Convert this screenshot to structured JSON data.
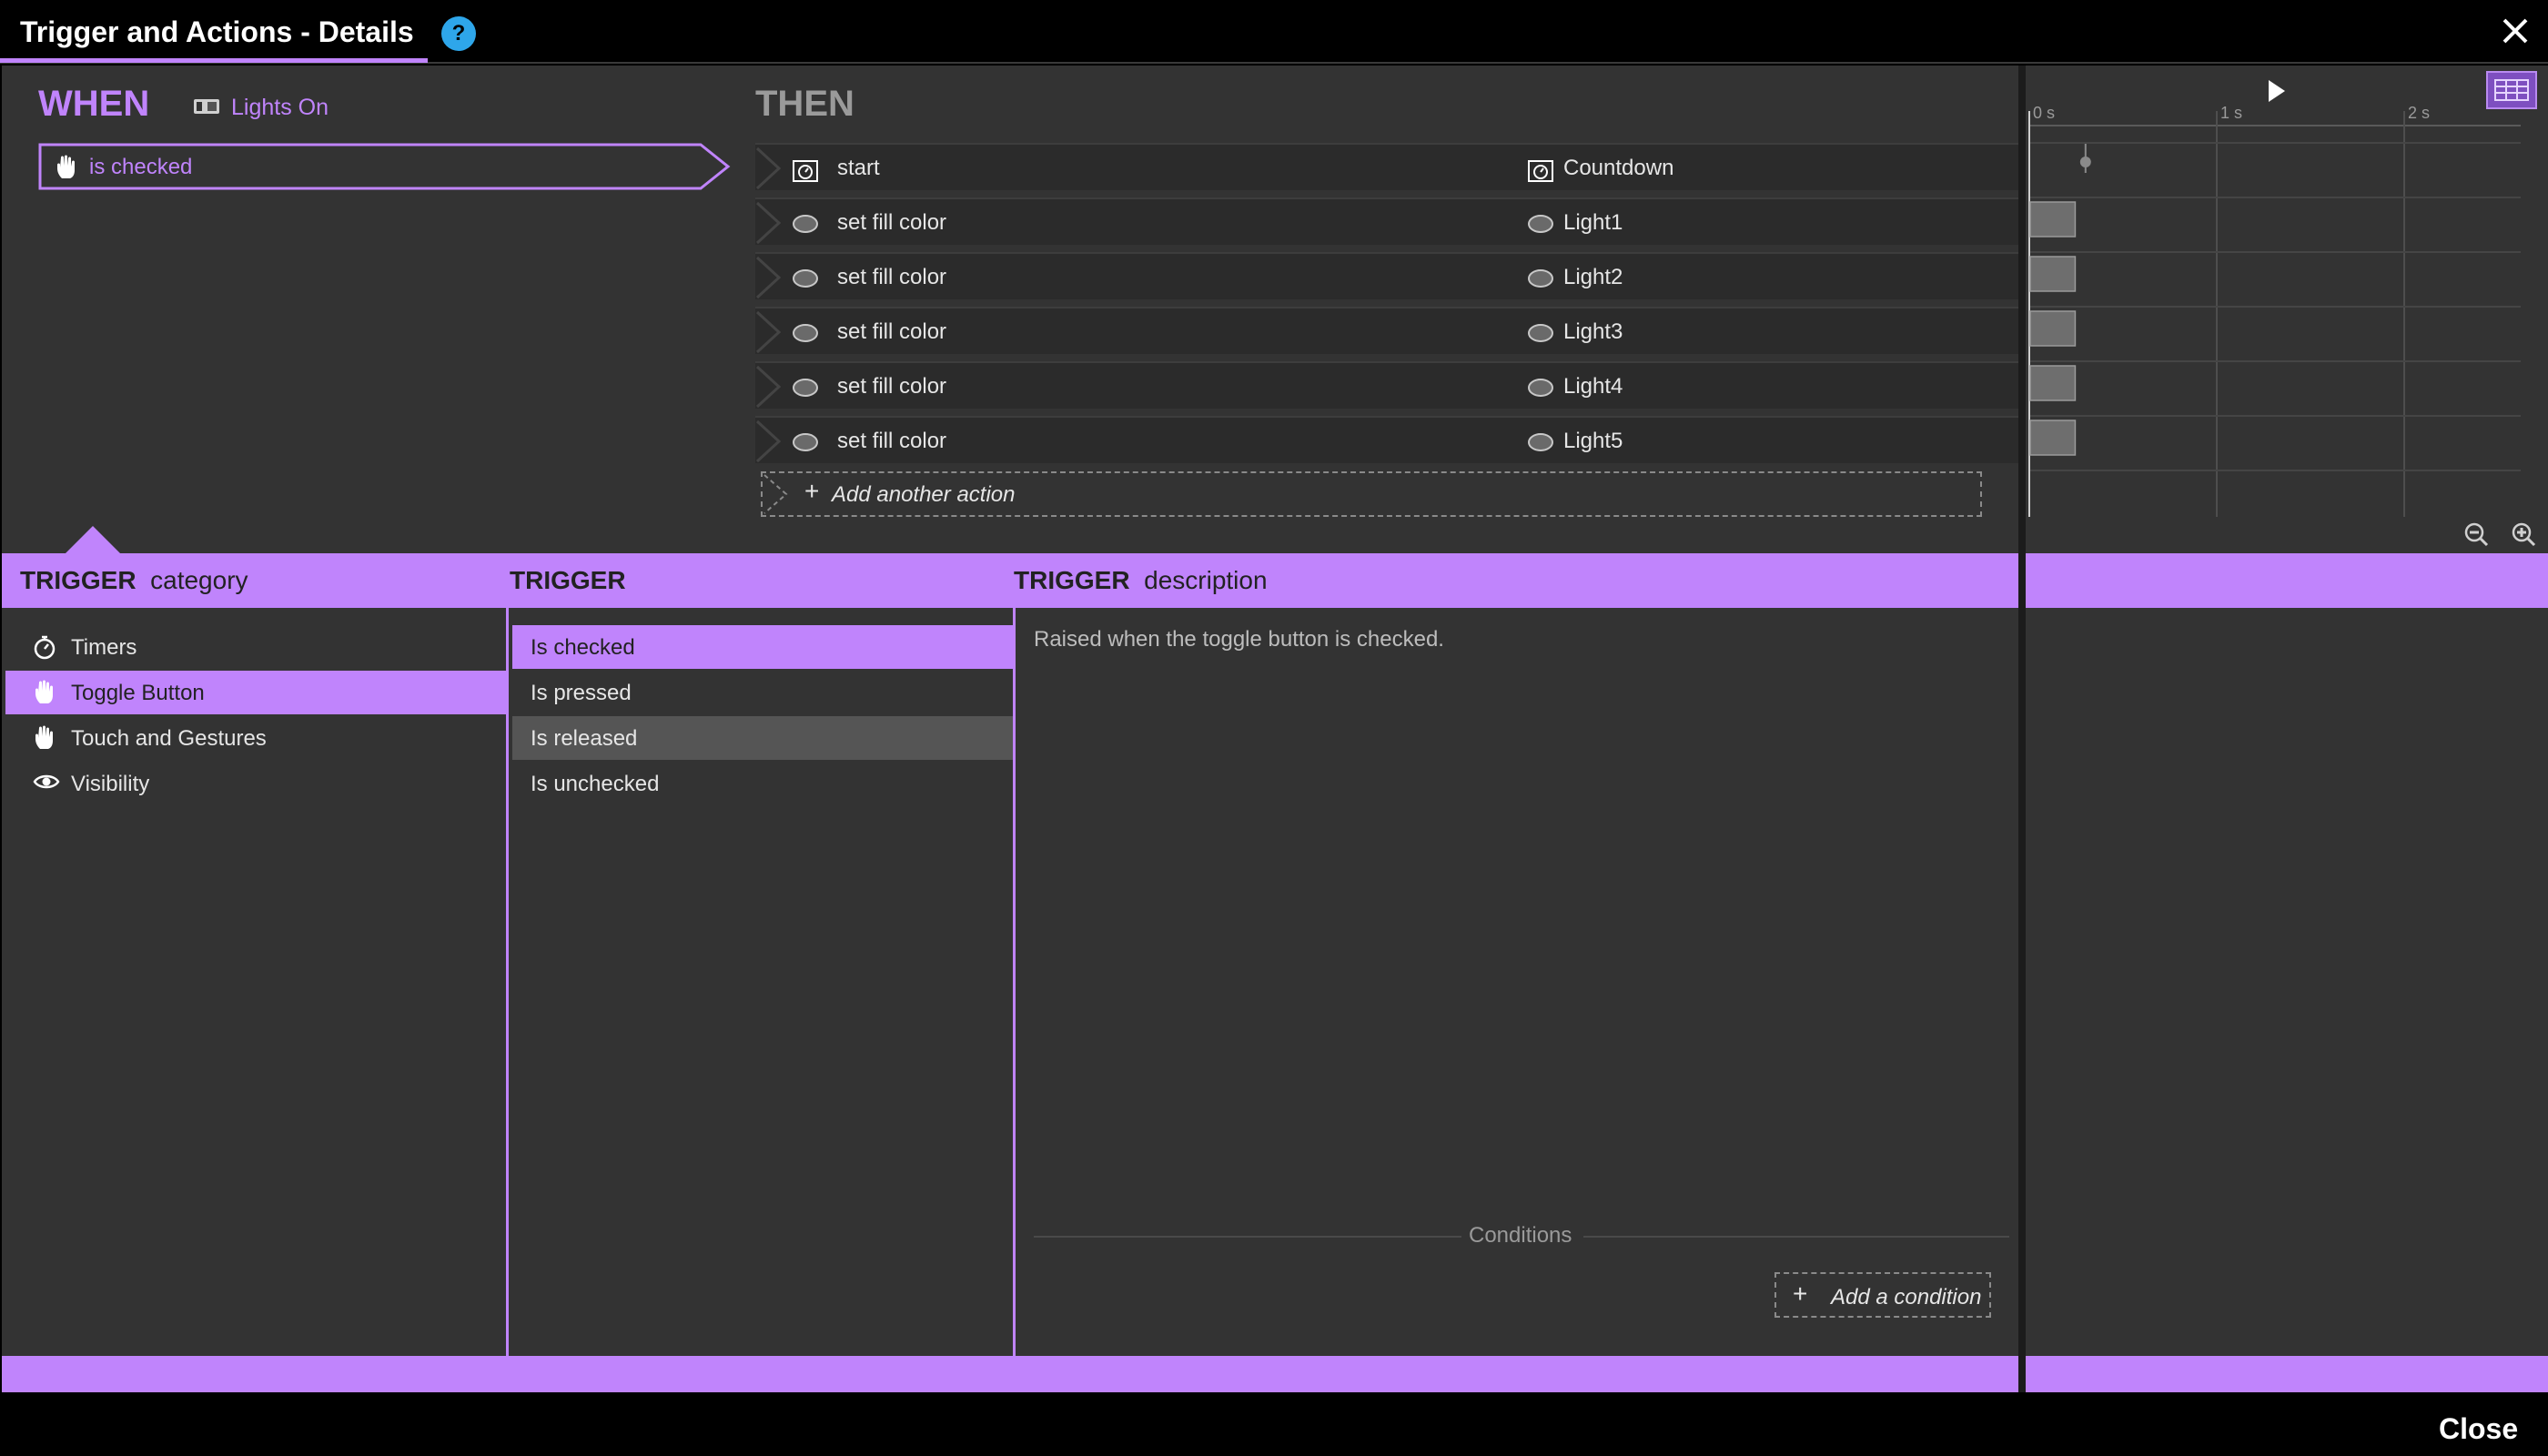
{
  "window": {
    "title": "Trigger and Actions - Details",
    "help_label": "?",
    "close_label": "Close"
  },
  "colors": {
    "accent": "#c084fc",
    "panel": "#333333",
    "help": "#2ea6ea"
  },
  "when": {
    "label": "WHEN",
    "source_icon": "toggle-button-icon",
    "source_name": "Lights On",
    "trigger_icon": "hand-icon",
    "trigger": "is checked"
  },
  "then": {
    "label": "THEN",
    "actions": [
      {
        "icon": "timer-component-icon",
        "action": "start",
        "target_icon": "timer-component-icon",
        "target": "Countdown"
      },
      {
        "icon": "ellipse-icon",
        "action": "set fill color",
        "target_icon": "ellipse-icon",
        "target": "Light1"
      },
      {
        "icon": "ellipse-icon",
        "action": "set fill color",
        "target_icon": "ellipse-icon",
        "target": "Light2"
      },
      {
        "icon": "ellipse-icon",
        "action": "set fill color",
        "target_icon": "ellipse-icon",
        "target": "Light3"
      },
      {
        "icon": "ellipse-icon",
        "action": "set fill color",
        "target_icon": "ellipse-icon",
        "target": "Light4"
      },
      {
        "icon": "ellipse-icon",
        "action": "set fill color",
        "target_icon": "ellipse-icon",
        "target": "Light5"
      }
    ],
    "add_action": "Add another action"
  },
  "timeline": {
    "ticks": [
      "0 s",
      "1 s",
      "2 s"
    ],
    "marker_seconds": 0.5,
    "bar_durations_seconds": [
      0.5,
      0.5,
      0.5,
      0.5,
      0.5
    ]
  },
  "trigger_category": {
    "header_bold": "TRIGGER",
    "header_rest": "category",
    "items": [
      {
        "icon": "stopwatch-icon",
        "label": "Timers"
      },
      {
        "icon": "hand-icon",
        "label": "Toggle Button",
        "selected": true
      },
      {
        "icon": "hand-icon",
        "label": "Touch and Gestures"
      },
      {
        "icon": "eye-icon",
        "label": "Visibility"
      }
    ]
  },
  "trigger_list": {
    "header": "TRIGGER",
    "items": [
      {
        "label": "Is checked",
        "selected": true
      },
      {
        "label": "Is pressed"
      },
      {
        "label": "Is released",
        "hover": true
      },
      {
        "label": "Is unchecked"
      }
    ]
  },
  "trigger_description": {
    "header_bold": "TRIGGER",
    "header_rest": "description",
    "text": "Raised when the toggle button is checked.",
    "conditions_label": "Conditions",
    "add_condition": "Add a condition"
  }
}
